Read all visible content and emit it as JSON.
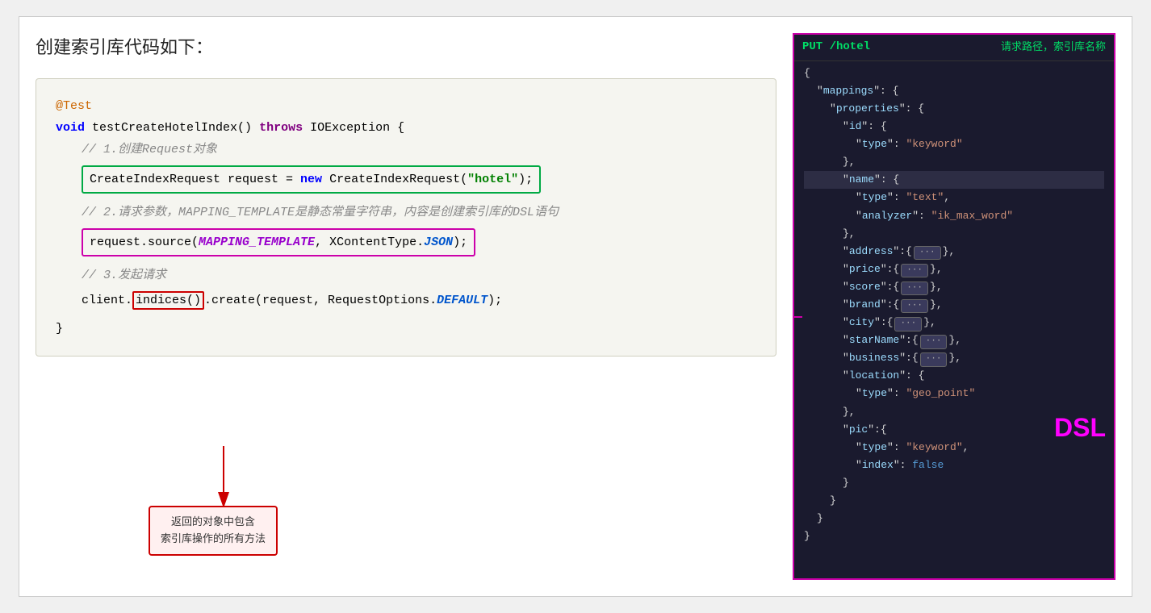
{
  "heading": "创建索引库代码如下：",
  "annotation_test": "@Test",
  "line1": "void testCreateHotelIndex() ",
  "throws": "throws",
  "line1b": " IOException {",
  "comment1": "// 1.创建Request对象",
  "line2a": "CreateIndexRequest request = ",
  "line2b": "new",
  "line2c": " CreateIndexRequest(",
  "line2d": "\"hotel\"",
  "line2e": ");",
  "comment2": "// 2.请求参数，MAPPING_TEMPLATE是静态常量字符串，内容是创建索引库的DSL语句",
  "line3a": "request.source(",
  "line3b": "MAPPING_TEMPLATE",
  "line3c": ", XContentType.",
  "line3d": "JSON",
  "line3e": ");",
  "comment3": "// 3.发起请求",
  "line4a": "client.",
  "line4b": "indices()",
  "line4c": ".create(request, RequestOptions.",
  "line4d": "DEFAULT",
  "line4e": ");",
  "closing_brace": "}",
  "annotation_red_line1": "返回的对象中包含",
  "annotation_red_line2": "索引库操作的所有方法",
  "right_put": "PUT /hotel",
  "right_comment": "请求路径，索引库名称",
  "dsl_label": "DSL",
  "right_code_lines": [
    "{",
    "  \"mappings\": {",
    "    \"properties\": {",
    "      \"id\": {",
    "        \"type\": \"keyword\"",
    "      },",
    "      \"name\": {",
    "        \"type\": \"text\",",
    "        \"analyzer\": \"ik_max_word\"",
    "      },",
    "      \"address\": {[...]}",
    "      \"price\": {[...]}",
    "      \"score\": {[...]}",
    "      \"brand\": {[...]}",
    "      \"city\": {[...]}",
    "      \"starName\": {[...]}",
    "      \"business\": {[...]}",
    "      \"location\": {",
    "        \"type\": \"geo_point\"",
    "      },",
    "      \"pic\": {",
    "        \"type\": \"keyword\",",
    "        \"index\": false",
    "      }",
    "    }",
    "  }",
    "}"
  ]
}
